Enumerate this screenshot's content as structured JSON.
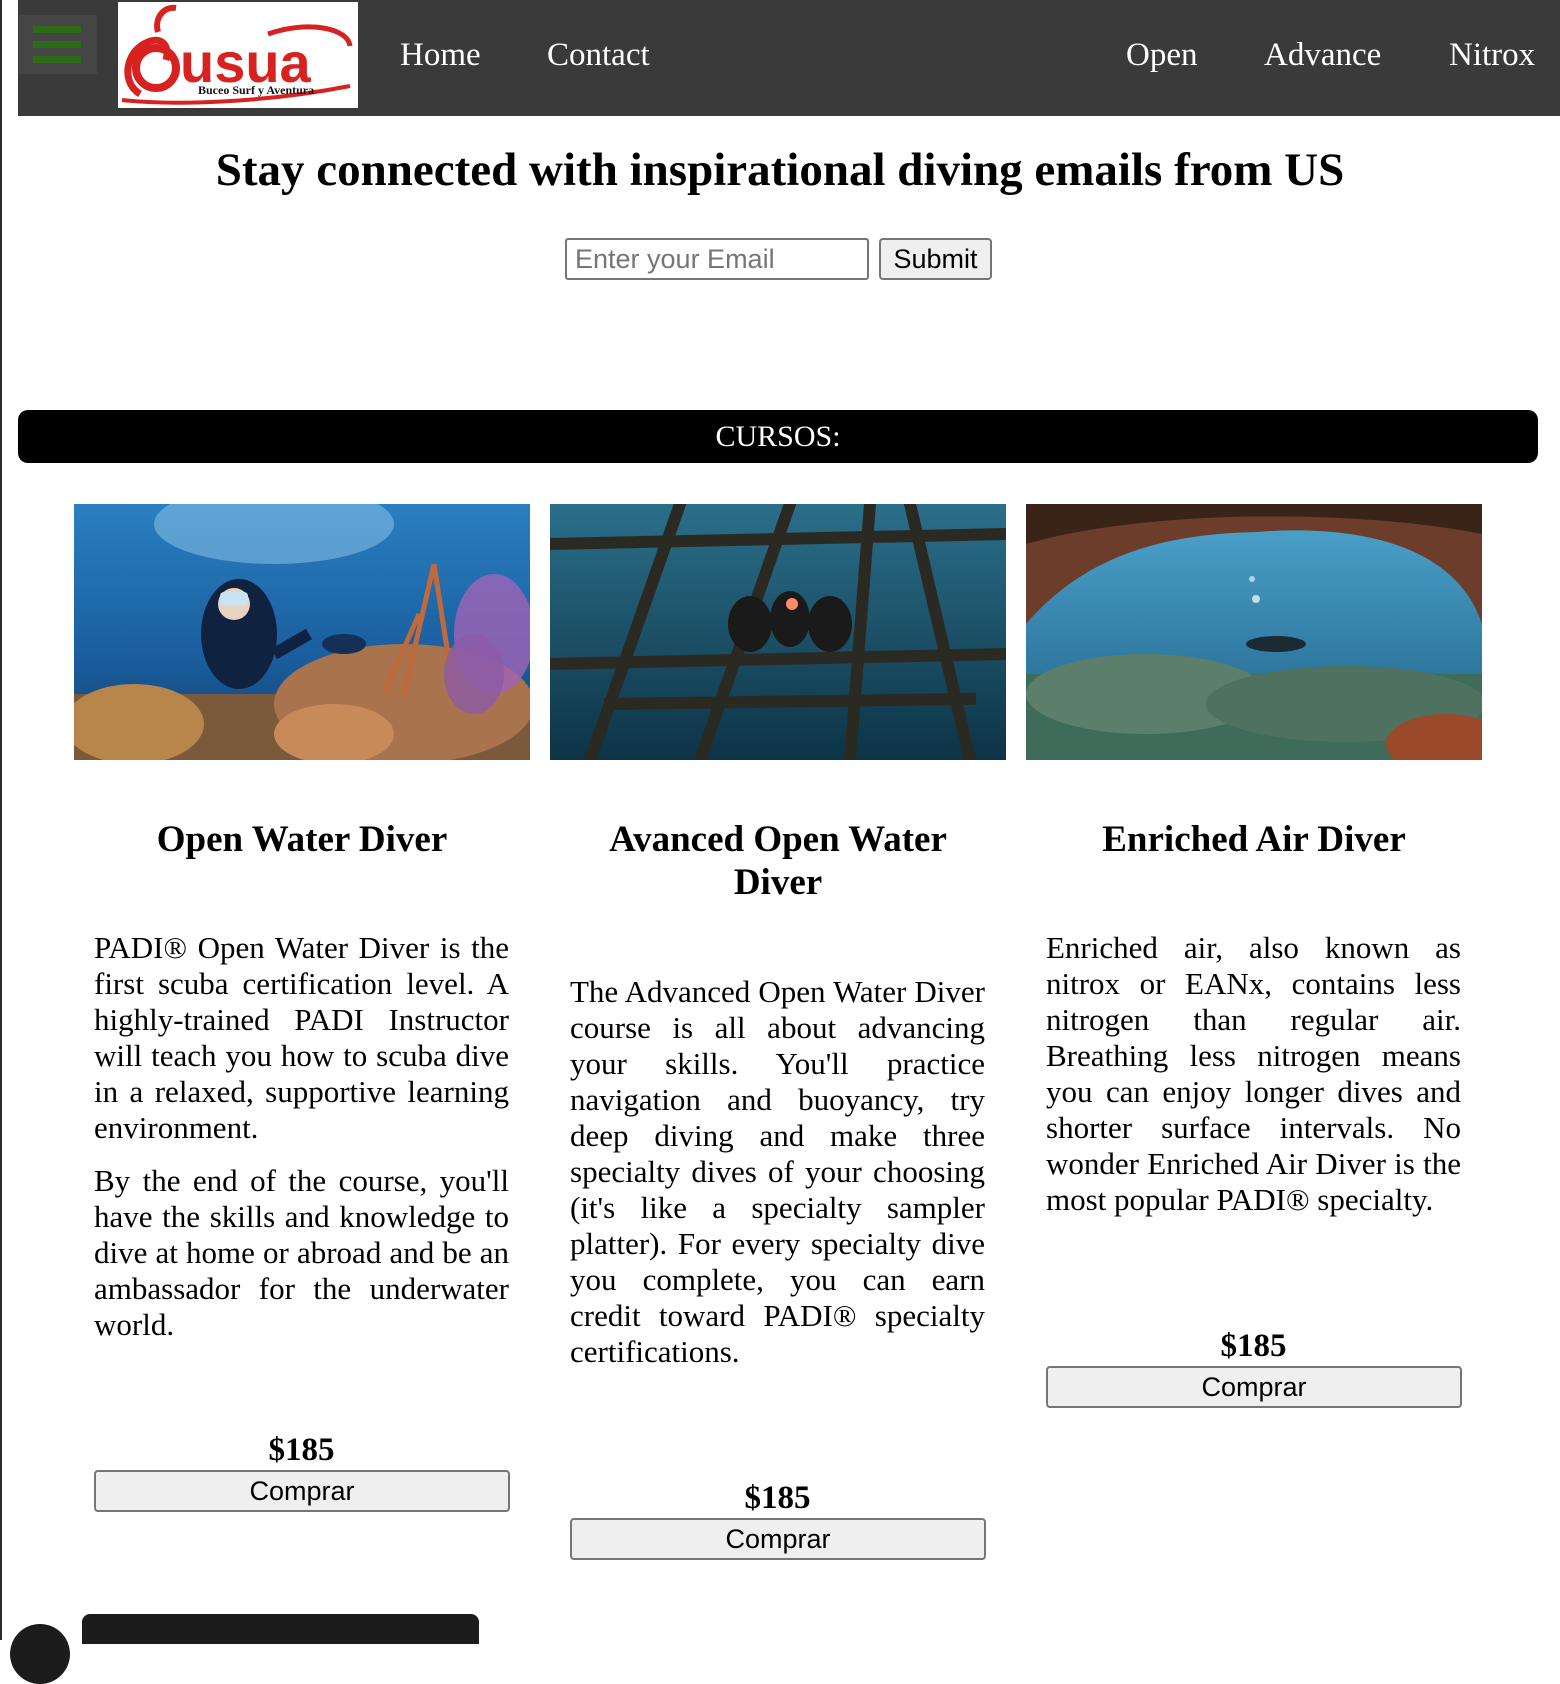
{
  "nav": {
    "logo_text": "usua",
    "logo_tagline": "Buceo Surf y Aventura",
    "links_left": [
      "Home",
      "Contact"
    ],
    "links_right": [
      "Open",
      "Advance",
      "Nitrox"
    ],
    "accent_color": "#2e6b18",
    "logo_red": "#d7221f"
  },
  "subscribe": {
    "headline": "Stay connected with inspirational diving emails from US",
    "email_placeholder": "Enter your Email",
    "email_value": "",
    "submit_label": "Submit"
  },
  "cursos_label": "CURSOS:",
  "courses": [
    {
      "title": "Open Water Diver",
      "paragraphs": [
        "PADI® Open Water Diver is the first scuba certification level. A highly-trained PADI Instructor will teach you how to scuba dive in a relaxed, supportive learning environment.",
        "By the end of the course, you'll have the skills and knowledge to dive at home or abroad and be an ambassador for the underwater world."
      ],
      "price": "$185",
      "buy_label": "Comprar",
      "image": "diver-coral-reef"
    },
    {
      "title": "Avanced Open Water Diver",
      "paragraphs": [
        "The Advanced Open Water Diver course is all about advancing your skills. You'll practice navigation and buoyancy, try deep diving and make three specialty dives of your choosing (it's like a specialty sampler platter). For every specialty dive you complete, you can earn credit toward PADI® specialty certifications."
      ],
      "price": "$185",
      "buy_label": "Comprar",
      "image": "divers-shipwreck"
    },
    {
      "title": "Enriched Air Diver",
      "paragraphs": [
        "Enriched air, also known as nitrox or EANx, contains less nitrogen than regular air. Breathing less nitrogen means you can enjoy longer dives and shorter surface intervals. No wonder Enriched Air Diver is the most popular PADI® specialty."
      ],
      "price": "$185",
      "buy_label": "Comprar",
      "image": "diver-underwater-cave"
    }
  ]
}
